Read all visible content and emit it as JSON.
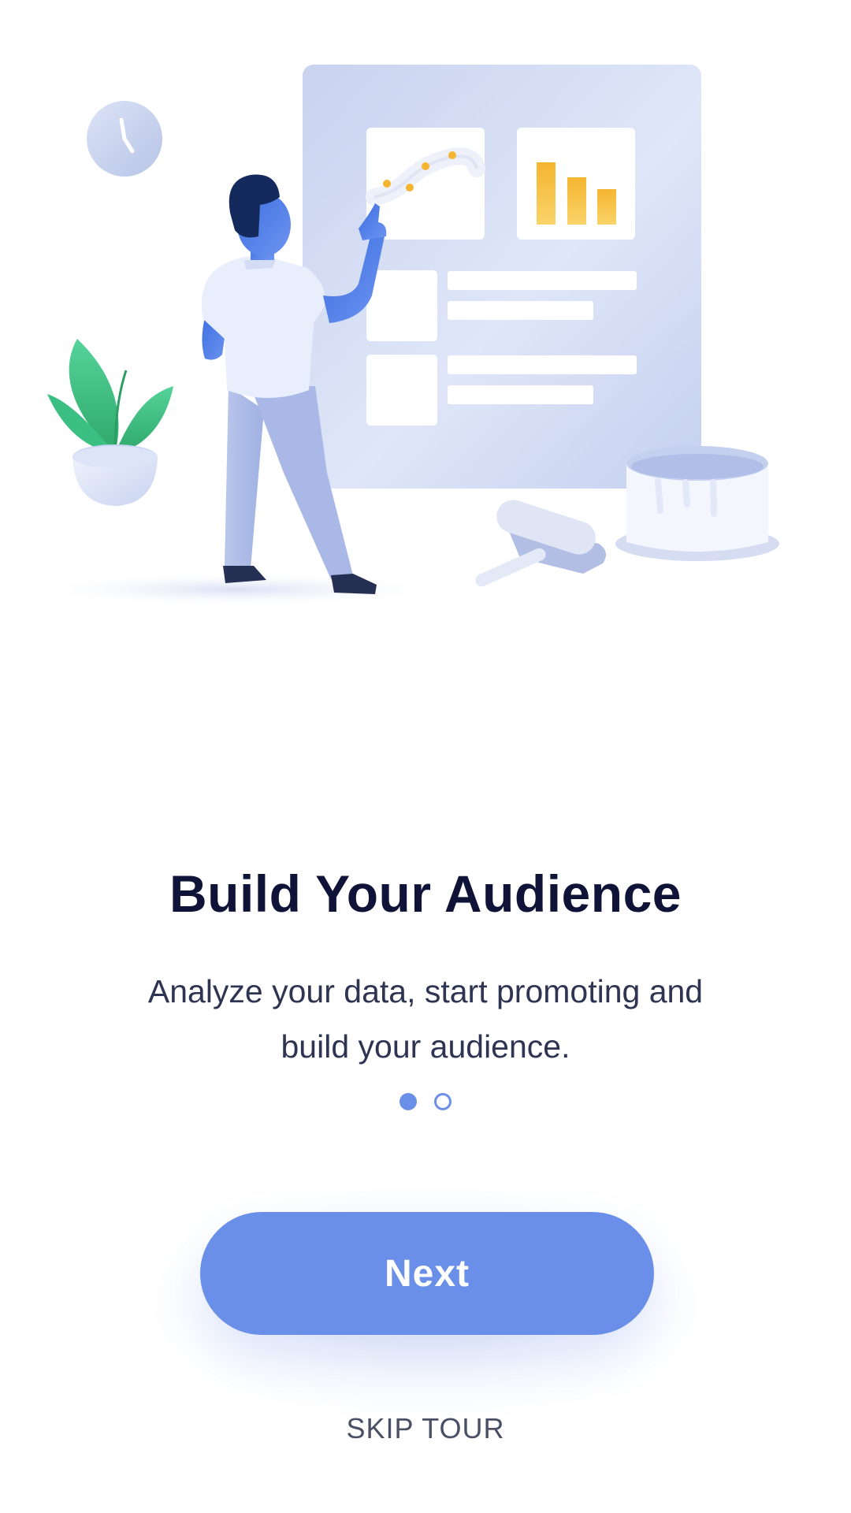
{
  "onboarding": {
    "title": "Build Your Audience",
    "description_lines": [
      "Analyze your data, start promoting and",
      "build your audience."
    ],
    "pager": {
      "total_pages": 2,
      "current_page": 1
    },
    "next_label": "Next",
    "skip_label": "SKIP TOUR"
  },
  "illustration": {
    "subject": "person pointing at analytics board",
    "icons": [
      "clock-icon",
      "plant-icon",
      "line-chart-icon",
      "bar-chart-icon",
      "paint-bucket-icon",
      "paint-roller-icon"
    ]
  },
  "colors": {
    "accent": "#6a8fe8",
    "title_text": "#0f1338",
    "body_text": "#2e3452",
    "chart_highlight": "#f5b530",
    "plant_green": "#3fc47f"
  }
}
